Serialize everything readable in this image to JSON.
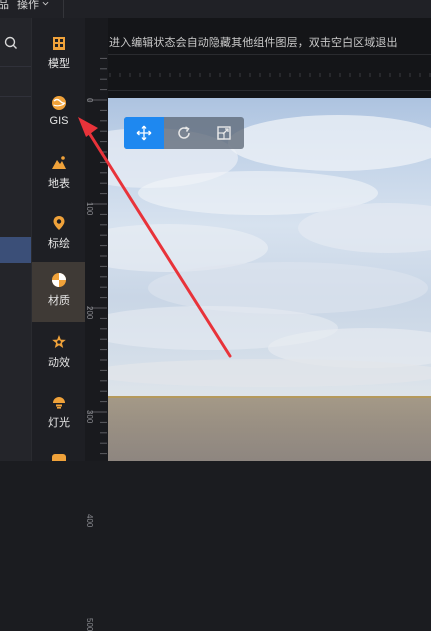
{
  "topbar": {
    "menu_left": "品",
    "menu_operate": "操作"
  },
  "hint_text": "进入编辑状态会自动隐藏其他组件图层，双击空白区域退出",
  "ruler": {
    "ticks": [
      "0",
      "100",
      "200",
      "300",
      "400",
      "500"
    ]
  },
  "tools": [
    {
      "label": "模型",
      "icon": "model-icon"
    },
    {
      "label": "GIS",
      "icon": "gis-icon"
    },
    {
      "label": "地表",
      "icon": "terrain-icon"
    },
    {
      "label": "标绘",
      "icon": "marker-icon"
    },
    {
      "label": "材质",
      "icon": "material-icon"
    },
    {
      "label": "动效",
      "icon": "effect-icon"
    },
    {
      "label": "灯光",
      "icon": "light-icon"
    }
  ],
  "gizmo": {
    "buttons": [
      "move-icon",
      "rotate-icon",
      "scale-icon"
    ],
    "active": "move-icon"
  },
  "colors": {
    "accent": "#1e88f0",
    "tool_icon": "#f0a23a",
    "annotation_arrow": "#e8333a"
  }
}
